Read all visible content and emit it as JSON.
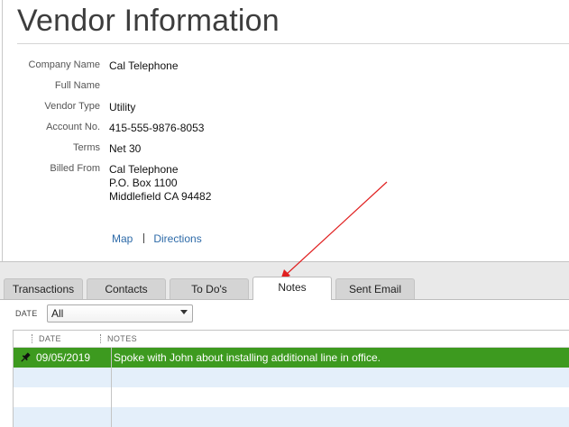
{
  "header": {
    "title": "Vendor Information"
  },
  "vendor": {
    "fields": [
      {
        "label": "Company Name",
        "value": "Cal Telephone"
      },
      {
        "label": "Full Name",
        "value": ""
      },
      {
        "label": "Vendor Type",
        "value": "Utility"
      },
      {
        "label": "Account No.",
        "value": "415-555-9876-8053"
      },
      {
        "label": "Terms",
        "value": "Net 30"
      }
    ],
    "billed_from": {
      "label": "Billed From",
      "lines": [
        "Cal Telephone",
        "P.O. Box 1100",
        "Middlefield CA 94482"
      ]
    },
    "links": {
      "map": "Map",
      "directions": "Directions"
    }
  },
  "tabs": [
    {
      "label": "Transactions",
      "active": false
    },
    {
      "label": "Contacts",
      "active": false
    },
    {
      "label": "To Do's",
      "active": false
    },
    {
      "label": "Notes",
      "active": true
    },
    {
      "label": "Sent Email",
      "active": false
    }
  ],
  "notes": {
    "filter": {
      "label": "DATE",
      "value": "All"
    },
    "columns": {
      "date": "DATE",
      "notes": "NOTES"
    },
    "rows": [
      {
        "date": "09/05/2019",
        "note": "Spoke with John about installing additional line in office.",
        "pinned": true
      }
    ]
  },
  "colors": {
    "selected_row": "#3d9a1f",
    "stripe": "#e4effa",
    "link": "#2d6aa8",
    "annotation_arrow": "#e02020"
  },
  "icons": {
    "pin": "pushpin-icon",
    "dropdown": "chevron-down-icon"
  }
}
